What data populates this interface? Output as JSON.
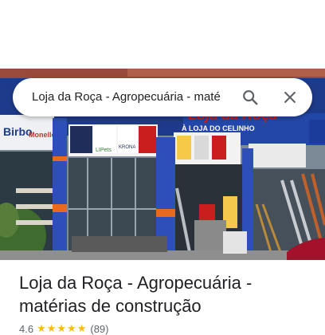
{
  "search": {
    "query": "Loja da Roça - Agropecuária - maté"
  },
  "icons": {
    "search": "search-icon",
    "close": "close-icon",
    "star": "star-icon"
  },
  "photo": {
    "store_sign_line1": "Loja da Roça",
    "store_sign_line2": "À LOJA DO CELINHO",
    "brand_signs": [
      "Birbo",
      "Monello",
      "",
      "",
      "LIPets",
      "KRONA",
      "",
      "",
      "",
      "",
      "",
      "",
      "",
      "",
      ""
    ]
  },
  "place": {
    "title": "Loja da Roça - Agropecuária - matérias de construção",
    "rating": "4.6",
    "stars": "★★★★★",
    "review_count": "(89)"
  },
  "colors": {
    "facade_blue": "#1e3a8a",
    "sign_red": "#c81e1e",
    "star_yellow": "#fbbc04",
    "text_dark": "#202124"
  }
}
